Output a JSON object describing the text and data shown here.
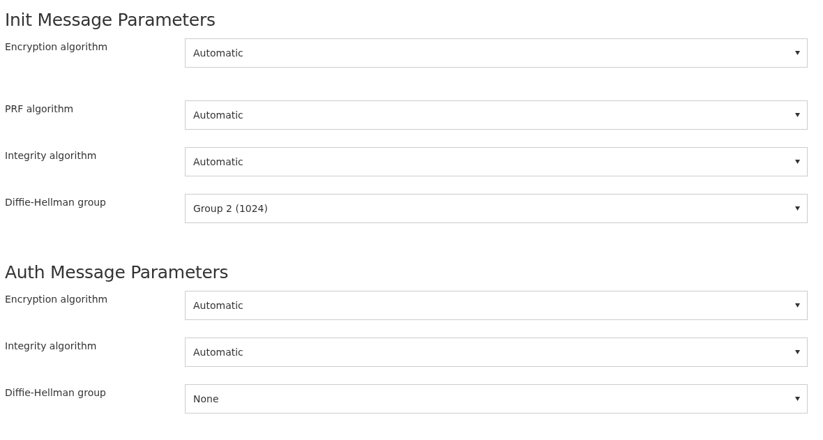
{
  "sections": [
    {
      "title": "Init Message Parameters",
      "fields": [
        {
          "label": "Encryption algorithm",
          "value": "Automatic"
        },
        {
          "label": "PRF algorithm",
          "value": "Automatic"
        },
        {
          "label": "Integrity algorithm",
          "value": "Automatic"
        },
        {
          "label": "Diffie-Hellman group",
          "value": "Group 2 (1024)"
        }
      ]
    },
    {
      "title": "Auth Message Parameters",
      "fields": [
        {
          "label": "Encryption algorithm",
          "value": "Automatic"
        },
        {
          "label": "Integrity algorithm",
          "value": "Automatic"
        },
        {
          "label": "Diffie-Hellman group",
          "value": "None"
        }
      ]
    }
  ]
}
